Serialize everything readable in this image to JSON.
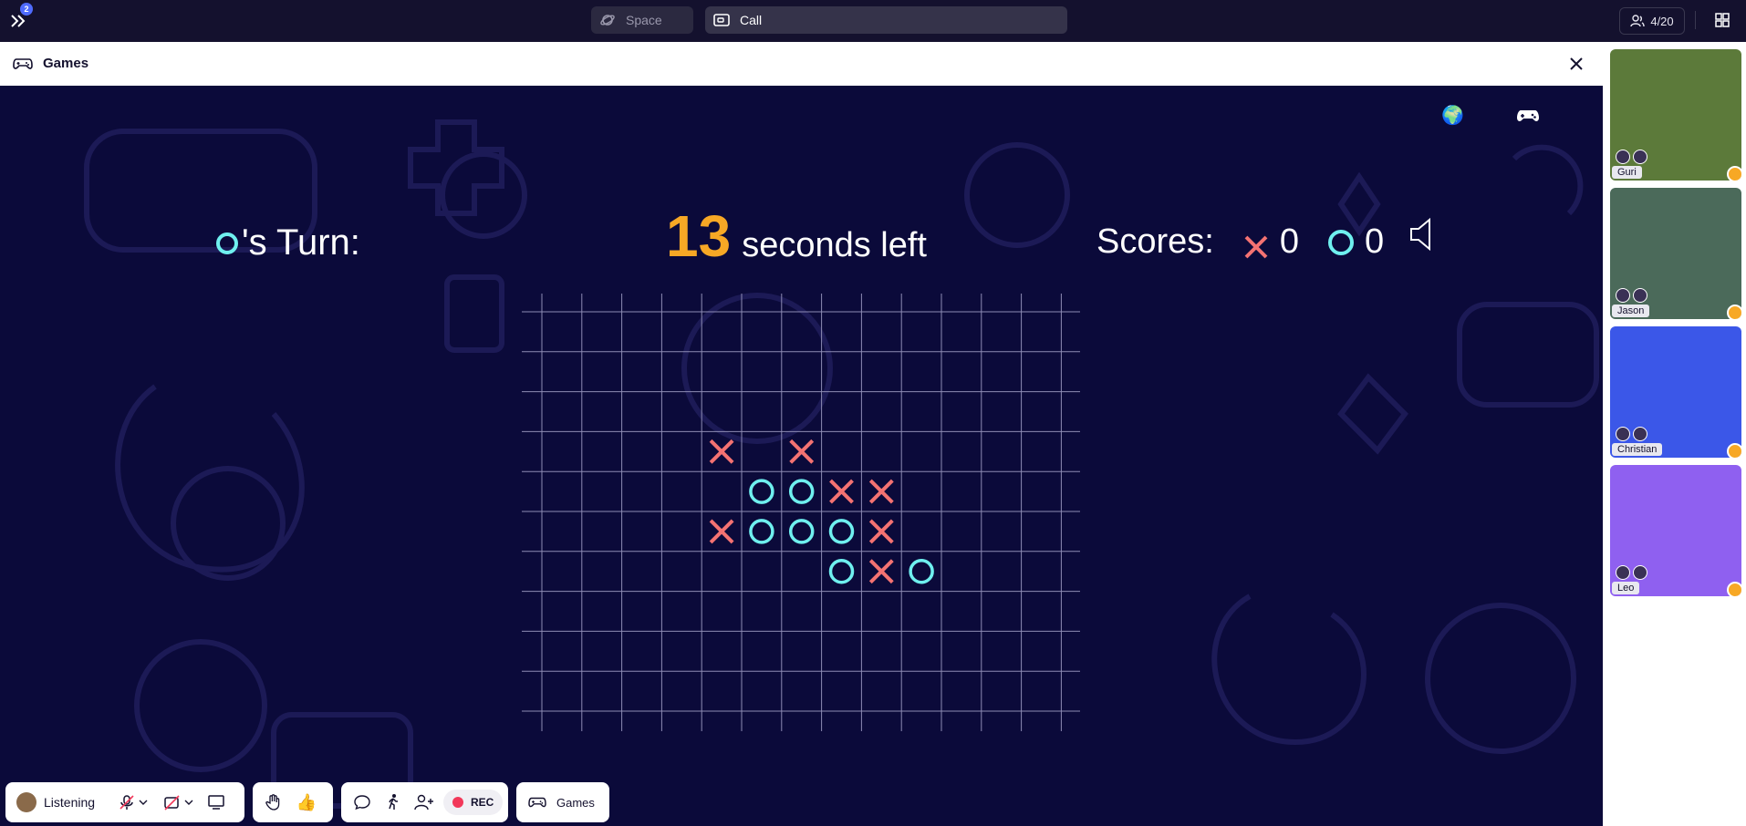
{
  "topbar": {
    "badge_count": "2",
    "tabs": [
      {
        "label": "Space",
        "icon": "planet-icon"
      },
      {
        "label": "Call",
        "icon": "video-camera-icon"
      }
    ],
    "people_count": "4/20"
  },
  "panel": {
    "title": "Games"
  },
  "game": {
    "turn_label": "'s Turn:",
    "turn_symbol": "O",
    "timer_value": "13",
    "timer_text": "seconds left",
    "scores_label": "Scores:",
    "score_x": "0",
    "score_o": "0",
    "colors": {
      "x": "#f47272",
      "o": "#6ff0ef",
      "timer": "#f7a825",
      "background": "#0b0a3a"
    },
    "board": {
      "cols": 13,
      "rows": 10,
      "marks": [
        {
          "col": 4,
          "row": 3,
          "symbol": "X"
        },
        {
          "col": 6,
          "row": 3,
          "symbol": "X"
        },
        {
          "col": 5,
          "row": 4,
          "symbol": "O"
        },
        {
          "col": 6,
          "row": 4,
          "symbol": "O"
        },
        {
          "col": 7,
          "row": 4,
          "symbol": "X"
        },
        {
          "col": 8,
          "row": 4,
          "symbol": "X"
        },
        {
          "col": 4,
          "row": 5,
          "symbol": "X"
        },
        {
          "col": 5,
          "row": 5,
          "symbol": "O"
        },
        {
          "col": 6,
          "row": 5,
          "symbol": "O"
        },
        {
          "col": 7,
          "row": 5,
          "symbol": "O"
        },
        {
          "col": 8,
          "row": 5,
          "symbol": "X"
        },
        {
          "col": 7,
          "row": 6,
          "symbol": "O"
        },
        {
          "col": 8,
          "row": 6,
          "symbol": "X"
        },
        {
          "col": 9,
          "row": 6,
          "symbol": "O"
        }
      ]
    }
  },
  "participants": [
    {
      "name": "Guri",
      "color": "#5c7a3a"
    },
    {
      "name": "Jason",
      "color": "#4b6a5a"
    },
    {
      "name": "Christian",
      "color": "#3b57e8"
    },
    {
      "name": "Leo",
      "color": "#8f60f0"
    }
  ],
  "bottombar": {
    "status_label": "Listening",
    "rec_label": "REC",
    "games_label": "Games"
  }
}
